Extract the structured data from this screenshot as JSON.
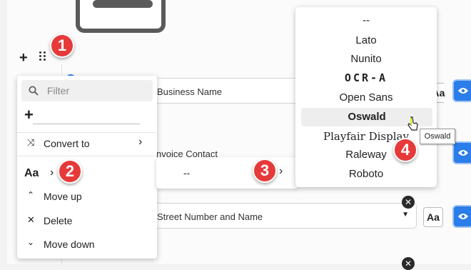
{
  "steps": [
    "1",
    "2",
    "3",
    "4"
  ],
  "form": {
    "fields": [
      {
        "label": "Business Name"
      },
      {
        "label": "nvoice Contact"
      },
      {
        "label": "Street Number and Name"
      }
    ],
    "format_label": "Aa"
  },
  "block_menu": {
    "filter_placeholder": "Filter",
    "add_symbol": "+",
    "convert_label": "Convert to",
    "format_label": "Aa",
    "move_up_label": "Move up",
    "delete_label": "Delete",
    "move_down_label": "Move down"
  },
  "font_submenu": {
    "current_value": "--"
  },
  "font_list": {
    "items": [
      "--",
      "Lato",
      "Nunito",
      "OCR-A",
      "Open Sans",
      "Oswald",
      "Playfair Display",
      "Raleway",
      "Roboto"
    ],
    "highlighted": "Oswald"
  },
  "tooltip": "Oswald",
  "icons": [
    "add-icon",
    "drag-handle-icon",
    "search-icon",
    "convert-icon",
    "chevron-right-icon",
    "chevron-up-icon",
    "close-icon",
    "chevron-down-icon",
    "eye-icon",
    "clear-icon",
    "pointer-cursor-icon"
  ]
}
